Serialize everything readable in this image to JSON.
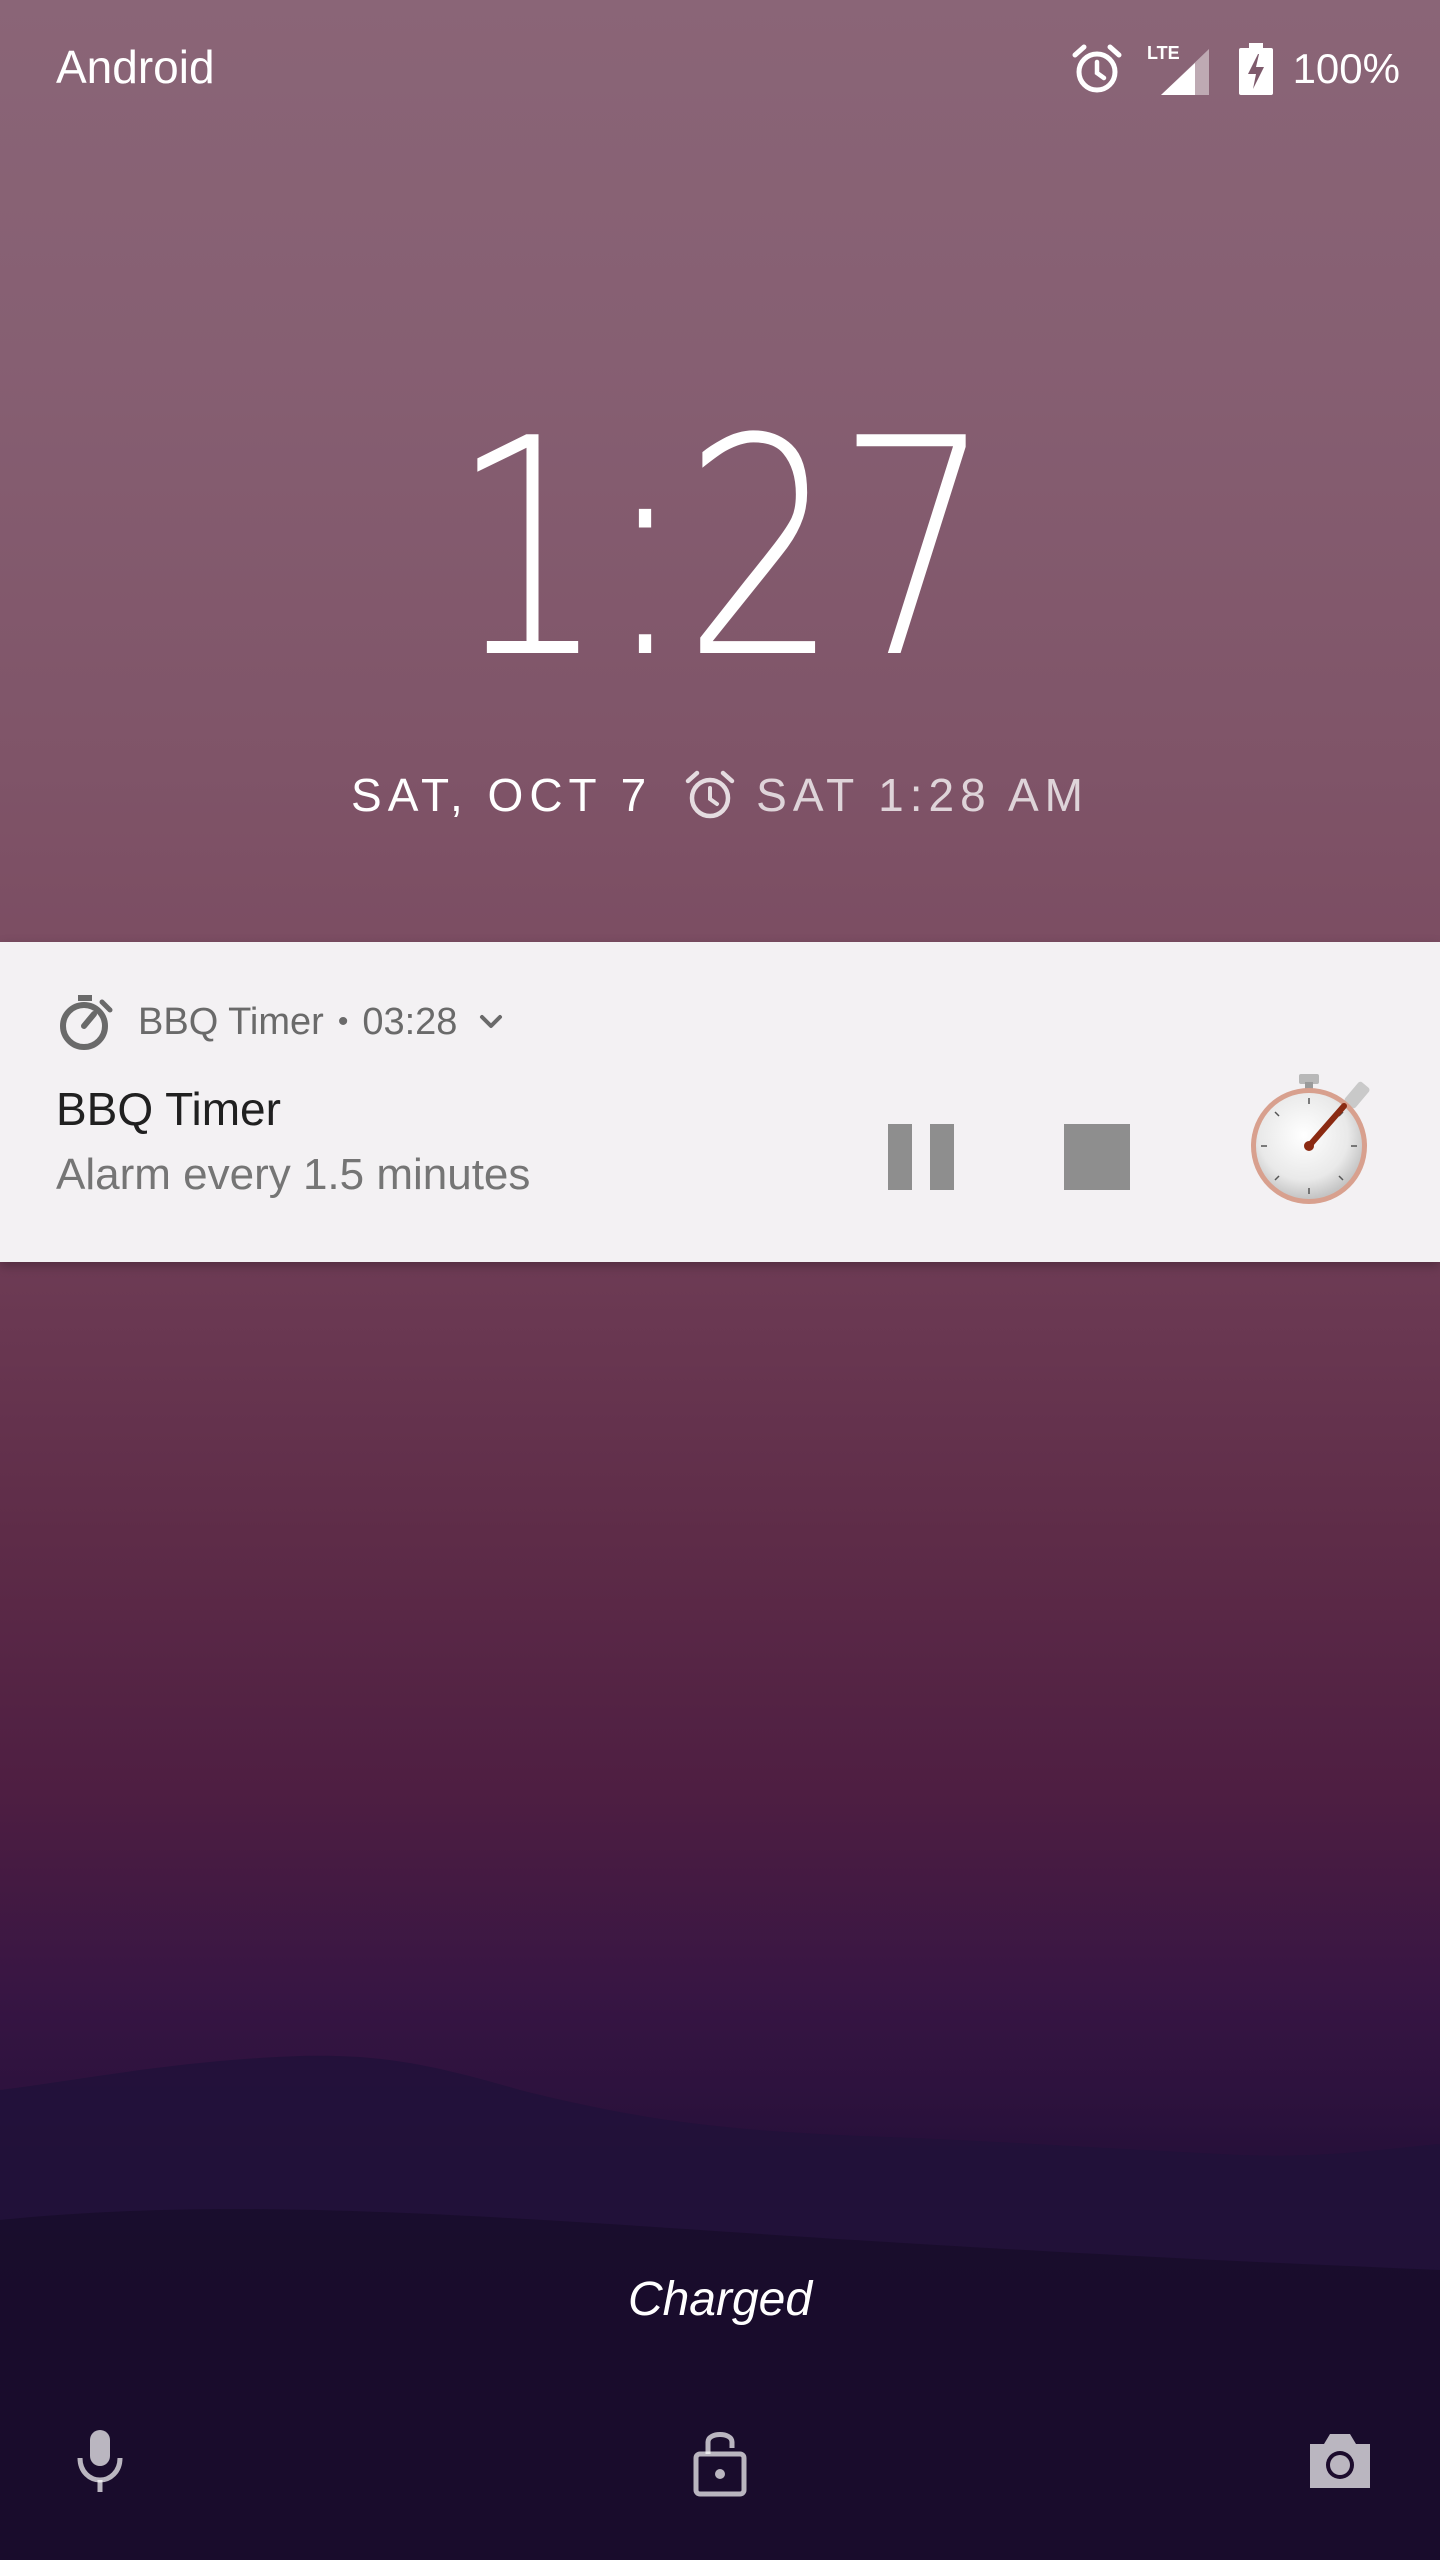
{
  "status_bar": {
    "carrier": "Android",
    "battery": "100%",
    "icons": [
      "alarm-icon",
      "lte-signal-icon",
      "battery-charging-icon"
    ]
  },
  "lockscreen": {
    "time": "1:27",
    "date": "SAT, OCT 7",
    "next_alarm": "SAT 1:28 AM"
  },
  "notification": {
    "app_name": "BBQ Timer",
    "separator": "•",
    "elapsed": "03:28",
    "title": "BBQ Timer",
    "text": "Alarm every 1.5 minutes",
    "actions": [
      "pause-icon",
      "stop-icon"
    ],
    "large_icon": "stopwatch-icon"
  },
  "bottom": {
    "charging_status": "Charged",
    "icons": [
      "microphone-icon",
      "unlock-icon",
      "camera-icon"
    ]
  },
  "colors": {
    "notification_bg": "#f3f1f3",
    "action_icon": "#8e8e8e",
    "text_primary": "#202020",
    "text_secondary": "#757575"
  }
}
